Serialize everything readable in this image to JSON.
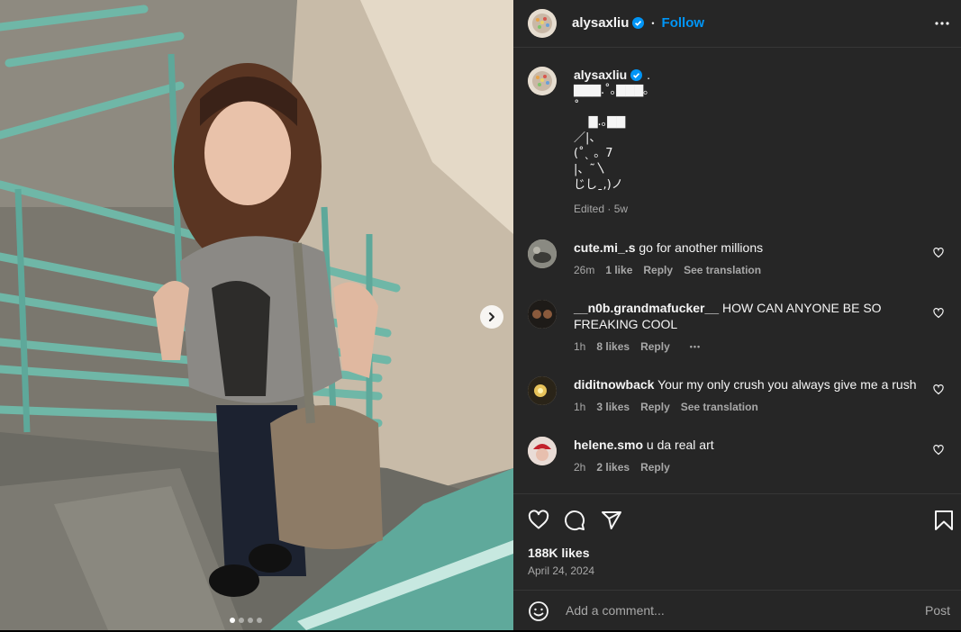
{
  "post": {
    "username": "alysaxliu",
    "follow_label": "Follow",
    "separator": "•",
    "caption_suffix": ".",
    "caption_art": "▇▇▇.˚｡▇▇▇｡\n˚\n    ▇.｡▇▇\n／|、\n(˚ˎ 。7\n|、˜〵\nじしˍ,)ノ",
    "edited": "Edited · 5w",
    "likes": "188K likes",
    "date": "April 24, 2024"
  },
  "comments": [
    {
      "user": "cute.mi_.s",
      "text": "go for another millions",
      "time": "26m",
      "likes": "1 like",
      "reply": "Reply",
      "translate": "See translation",
      "more": ""
    },
    {
      "user": "__n0b.grandmafucker__",
      "text": "HOW CAN ANYONE BE SO FREAKING COOL",
      "time": "1h",
      "likes": "8 likes",
      "reply": "Reply",
      "translate": "",
      "more": "•••"
    },
    {
      "user": "diditnowback",
      "text": "Your my only crush you always give me a rush",
      "time": "1h",
      "likes": "3 likes",
      "reply": "Reply",
      "translate": "See translation",
      "more": ""
    },
    {
      "user": "helene.smo",
      "text": "u da real art",
      "time": "2h",
      "likes": "2 likes",
      "reply": "Reply",
      "translate": "",
      "more": ""
    }
  ],
  "composer": {
    "placeholder": "Add a comment...",
    "post_label": "Post"
  },
  "icons": {
    "like": "heart-icon",
    "comment": "comment-icon",
    "share": "share-icon",
    "save": "bookmark-icon",
    "emoji": "emoji-icon",
    "more": "more-options-icon",
    "next": "chevron-right-icon",
    "verified": "verified-badge-icon"
  },
  "colors": {
    "accent": "#0095f6",
    "panel_bg": "#262626",
    "muted": "#a8a8a8"
  }
}
